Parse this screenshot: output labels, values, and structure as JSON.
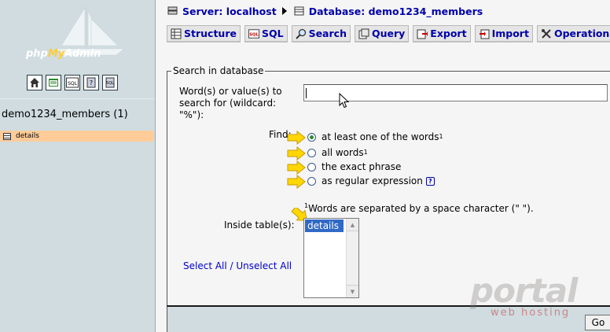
{
  "navigation": {
    "logo_text": {
      "part1": "php",
      "part2": "My",
      "part3": "Admin"
    },
    "icons": [
      "home-icon",
      "query-window-icon",
      "sql-icon",
      "docs-icon",
      "sql-docs-icon"
    ],
    "db_name": "demo1234_members (1)",
    "tables": [
      {
        "label": "details"
      }
    ]
  },
  "breadcrumb": {
    "server": "Server: localhost",
    "database": "Database: demo1234_members"
  },
  "tabs": [
    {
      "label": "Structure",
      "icon": "structure-icon"
    },
    {
      "label": "SQL",
      "icon": "sql-icon"
    },
    {
      "label": "Search",
      "icon": "search-icon"
    },
    {
      "label": "Query",
      "icon": "query-icon"
    },
    {
      "label": "Export",
      "icon": "export-icon"
    },
    {
      "label": "Import",
      "icon": "import-icon"
    },
    {
      "label": "Operations",
      "icon": "operations-icon"
    }
  ],
  "search_form": {
    "legend": "Search in database",
    "words_label": "Word(s) or value(s) to search for (wildcard: \"%\"):",
    "words_value": "",
    "find_label": "Find:",
    "options": [
      {
        "label": "at least one of the words",
        "sup": "1",
        "selected": true
      },
      {
        "label": "all words",
        "sup": "1",
        "selected": false
      },
      {
        "label": "the exact phrase",
        "sup": "",
        "selected": false
      },
      {
        "label": "as regular expression",
        "sup": "",
        "selected": false
      }
    ],
    "footnote_sup": "1",
    "footnote_text": "Words are separated by a space character (\" \").",
    "inside_tables_label": "Inside table(s):",
    "tables": [
      "details"
    ],
    "select_all": "Select All",
    "separator": " / ",
    "unselect_all": "Unselect All",
    "go_button": "Go"
  },
  "watermark": {
    "brand": "portal",
    "tagline": "web hosting"
  },
  "colors": {
    "link": "#0000aa",
    "left_frame": "#d0dce0",
    "selected_table": "#ffcc99",
    "selection": "#316ac5"
  }
}
